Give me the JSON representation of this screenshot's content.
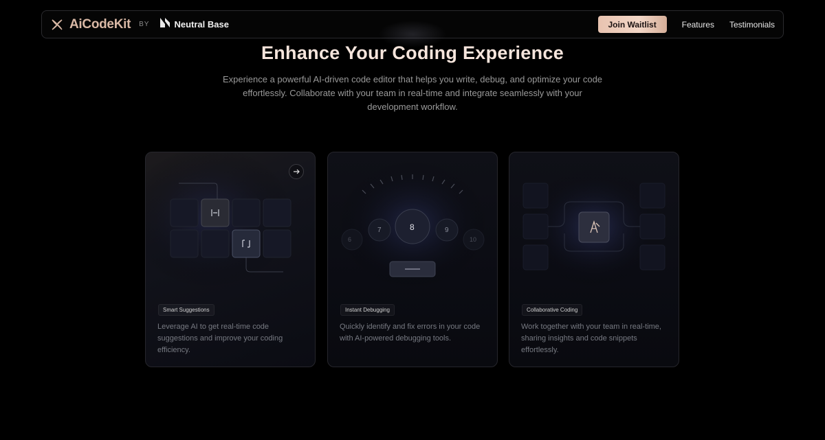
{
  "nav": {
    "brand": "AiCodeKit",
    "by": "BY",
    "partner": "Neutral Base",
    "cta": "Join Waitlist",
    "links": [
      "Features",
      "Testimonials"
    ]
  },
  "hero": {
    "title": "Enhance Your Coding Experience",
    "subtitle": "Experience a powerful AI-driven code editor that helps you write, debug, and optimize your code effortlessly. Collaborate with your team in real-time and integrate seamlessly with your development workflow."
  },
  "cards": [
    {
      "tag": "Smart Suggestions",
      "description": "Leverage AI to get real-time code suggestions and improve your coding efficiency."
    },
    {
      "tag": "Instant Debugging",
      "description": "Quickly identify and fix errors in your code with AI-powered debugging tools.",
      "dial_numbers": [
        "6",
        "7",
        "8",
        "9",
        "10"
      ]
    },
    {
      "tag": "Collaborative Coding",
      "description": "Work together with your team in real-time, sharing insights and code snippets effortlessly."
    }
  ],
  "colors": {
    "accent": "#e8c3b0",
    "brand_text": "#d9b8a5",
    "title": "#f6e5dc",
    "background": "#000000"
  },
  "icons": {
    "brand": "brand-logo-icon",
    "partner": "neutral-base-logo-icon",
    "card_arrow": "arrow-right-icon"
  }
}
